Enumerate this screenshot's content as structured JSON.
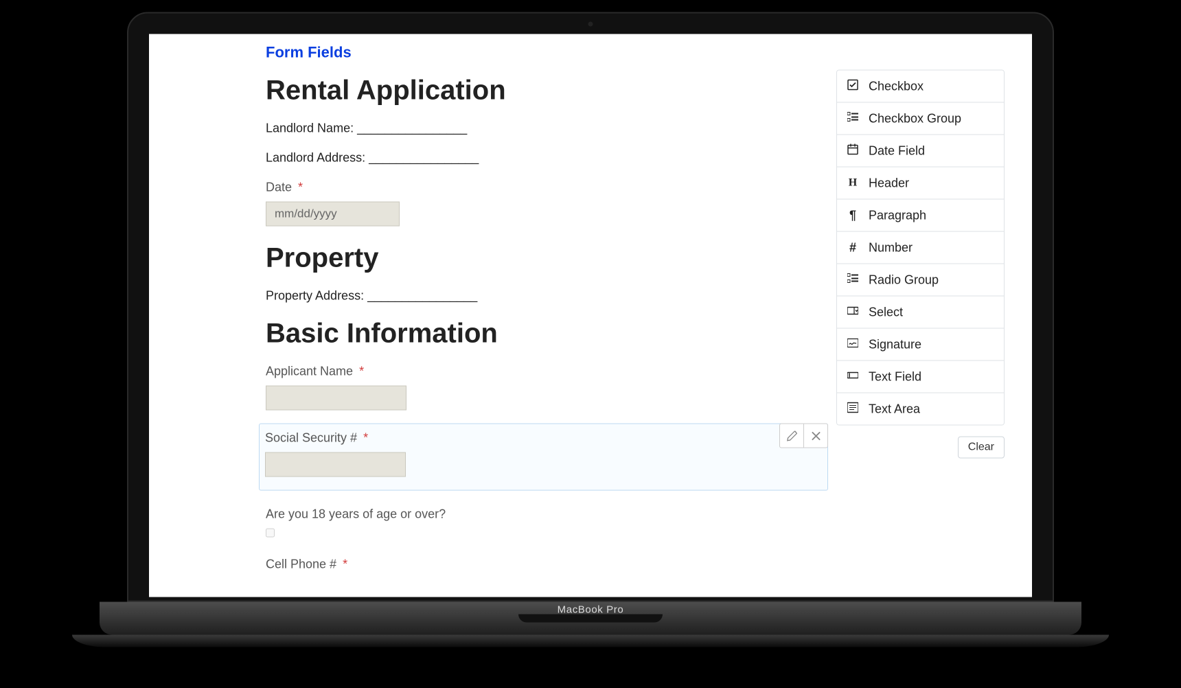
{
  "page_title": "Form Fields",
  "laptop_label": "MacBook Pro",
  "headings": {
    "h1": "Rental Application",
    "h2": "Property",
    "h3": "Basic Information"
  },
  "paragraphs": {
    "landlord_name": "Landlord Name: ________________",
    "landlord_address": "Landlord Address: ________________",
    "property_address": "Property Address: ________________"
  },
  "fields": {
    "date": {
      "label": "Date",
      "required": true,
      "placeholder": "mm/dd/yyyy"
    },
    "applicant_name": {
      "label": "Applicant Name",
      "required": true
    },
    "ssn": {
      "label": "Social Security #",
      "required": true
    },
    "age_q": {
      "label": "Are you 18 years of age or over?"
    },
    "cell": {
      "label": "Cell Phone #",
      "required": true
    }
  },
  "required_marker": "*",
  "toolbar": {
    "edit_name": "pencil-icon",
    "close_name": "close-icon"
  },
  "palette": [
    {
      "icon": "check-square",
      "label": "Checkbox"
    },
    {
      "icon": "list-check",
      "label": "Checkbox Group"
    },
    {
      "icon": "calendar",
      "label": "Date Field"
    },
    {
      "icon": "H",
      "label": "Header"
    },
    {
      "icon": "pilcrow",
      "label": "Paragraph"
    },
    {
      "icon": "hash",
      "label": "Number"
    },
    {
      "icon": "list-check",
      "label": "Radio Group"
    },
    {
      "icon": "select",
      "label": "Select"
    },
    {
      "icon": "signature",
      "label": "Signature"
    },
    {
      "icon": "text-field",
      "label": "Text Field"
    },
    {
      "icon": "text-area",
      "label": "Text Area"
    }
  ],
  "clear_label": "Clear"
}
